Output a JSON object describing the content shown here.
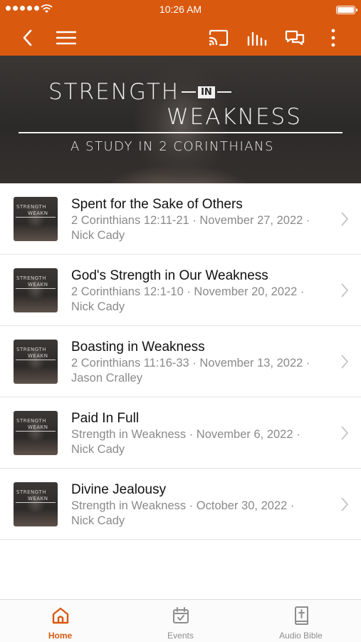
{
  "status_bar": {
    "time": "10:26 AM"
  },
  "colors": {
    "accent": "#d9590f",
    "text": "#111111",
    "secondary_text": "#8a8a8a"
  },
  "nav": {
    "icons": [
      "back-arrow-icon",
      "menu-icon",
      "cast-icon",
      "audio-bars-icon",
      "chat-icon",
      "more-vertical-icon"
    ]
  },
  "hero": {
    "line1_a": "STRENGTH",
    "line1_in": "IN",
    "line2": "WEAKNESS",
    "line3": "A STUDY IN 2 CORINTHIANS"
  },
  "thumb": {
    "line1": "STRENGTH",
    "line2": "WEAKN"
  },
  "sermons": [
    {
      "title": "Spent for the Sake of Others",
      "line1": "2 Corinthians 12:11-21 · November 27, 2022 ·",
      "line2": "Nick Cady"
    },
    {
      "title": "God's Strength in Our Weakness",
      "line1": "2 Corinthians 12:1-10 · November 20, 2022 ·",
      "line2": "Nick Cady"
    },
    {
      "title": "Boasting in Weakness",
      "line1": "2 Corinthians 11:16-33 · November 13, 2022 ·",
      "line2": "Jason Cralley"
    },
    {
      "title": "Paid In Full",
      "line1": "Strength in Weakness · November 6, 2022 ·",
      "line2": "Nick Cady"
    },
    {
      "title": "Divine Jealousy",
      "line1": "Strength in Weakness · October 30, 2022 ·",
      "line2": "Nick Cady"
    }
  ],
  "tabs": [
    {
      "label": "Home",
      "icon": "home-icon",
      "active": true
    },
    {
      "label": "Events",
      "icon": "calendar-icon",
      "active": false
    },
    {
      "label": "Audio Bible",
      "icon": "bible-icon",
      "active": false
    }
  ]
}
